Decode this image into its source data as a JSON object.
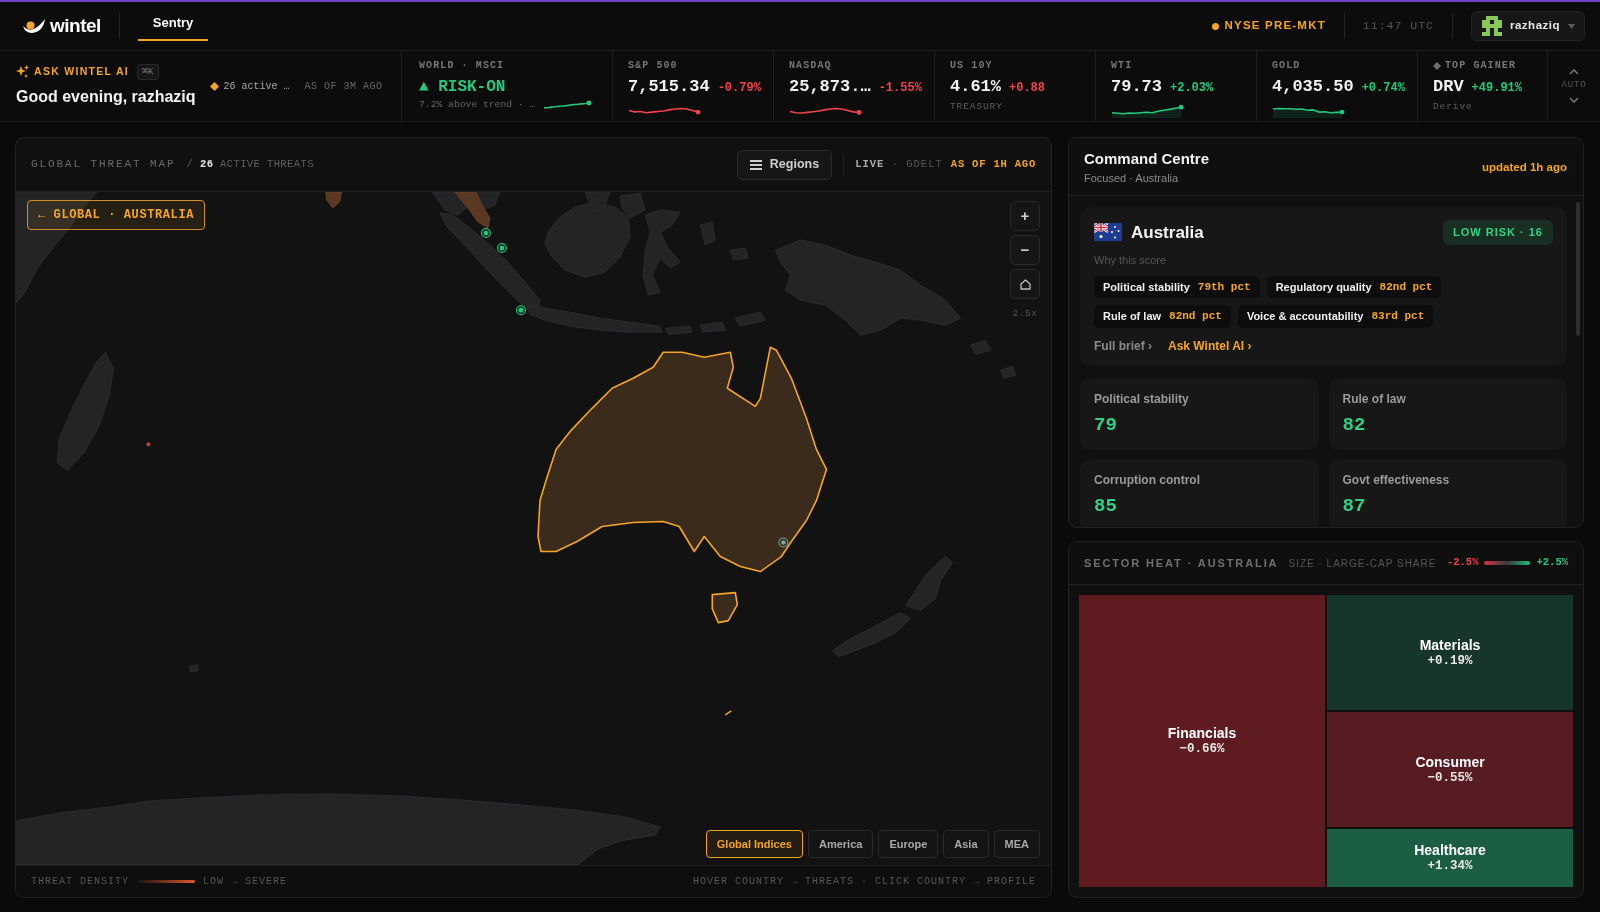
{
  "header": {
    "brand": "wintel",
    "tabs": [
      {
        "label": "Sentry",
        "selected": true
      }
    ],
    "market_status": "NYSE PRE-MKT",
    "clock": "11:47 UTC",
    "user": "razhaziq"
  },
  "ticker": {
    "assistant": {
      "label": "ASK WINTEL AI",
      "shortcut": "⌘K",
      "greeting": "Good evening, razhaziq",
      "alerts": "26 active …",
      "as_of": "AS OF 3M AGO"
    },
    "items": [
      {
        "kind": "signal",
        "label": "WORLD · MSCI",
        "value": "▲ RISK-ON",
        "note": "7.2% above trend · …",
        "color": "#22c97a"
      },
      {
        "kind": "quote",
        "label": "S&P 500",
        "value": "7,515.34",
        "change": "-0.79%",
        "color": "#f0434b"
      },
      {
        "kind": "quote",
        "label": "NASDAQ",
        "value": "25,873.…",
        "change": "-1.55%",
        "color": "#f0434b"
      },
      {
        "kind": "quote",
        "label": "US 10Y",
        "value": "4.61%",
        "change": "+0.88",
        "color": "#f0434b",
        "note": "TREASURY"
      },
      {
        "kind": "quote",
        "label": "WTI",
        "value": "79.73",
        "change": "+2.03%",
        "color": "#22c97a"
      },
      {
        "kind": "quote",
        "label": "GOLD",
        "value": "4,035.50",
        "change": "+0.74%",
        "color": "#22c97a"
      },
      {
        "kind": "gainer",
        "label": "TOP GAINER",
        "value": "DRV",
        "change": "+49.91%",
        "color": "#22c97a",
        "note": "Derive"
      }
    ],
    "auto": "AUTO"
  },
  "threat_map": {
    "title": "GLOBAL THREAT MAP",
    "subtitle": "/ **26** ACTIVE THREATS",
    "regions_button": "Regions",
    "feed": "**LIVE** · GDELT",
    "as_of": "AS OF 1H AGO",
    "breadcrumb": "← GLOBAL · AUSTRALIA",
    "zoom_controls": [
      "+",
      "−"
    ],
    "zoom_level": "2.5x",
    "filters": [
      {
        "label": "Global Indices",
        "selected": true
      },
      {
        "label": "America",
        "selected": false
      },
      {
        "label": "Europe",
        "selected": false
      },
      {
        "label": "Asia",
        "selected": false
      },
      {
        "label": "MEA",
        "selected": false
      }
    ],
    "legend": {
      "label": "THREAT DENSITY",
      "range": "LOW → SEVERE"
    },
    "hint": "HOVER COUNTRY → THREATS · CLICK COUNTRY → PROFILE"
  },
  "command_centre": {
    "title": "Command Centre",
    "subtitle": "Focused · Australia",
    "updated": "updated 1h ago",
    "country": {
      "name": "Australia",
      "risk": {
        "label": "LOW RISK · 16",
        "color": "#2fd47f"
      },
      "why": "Why this score",
      "factors": [
        {
          "label": "Political stability",
          "value": "79th pct"
        },
        {
          "label": "Regulatory quality",
          "value": "82nd pct"
        },
        {
          "label": "Rule of law",
          "value": "82nd pct"
        },
        {
          "label": "Voice & accountability",
          "value": "83rd pct"
        }
      ],
      "links": [
        {
          "label": "Full brief ›",
          "kind": "secondary"
        },
        {
          "label": "Ask Wintel AI ›",
          "kind": "primary"
        }
      ]
    },
    "metrics": [
      {
        "label": "Political stability",
        "value": "79"
      },
      {
        "label": "Rule of law",
        "value": "82"
      },
      {
        "label": "Corruption control",
        "value": "85"
      },
      {
        "label": "Govt effectiveness",
        "value": "87"
      }
    ]
  },
  "sector_heat": {
    "title": "SECTOR HEAT · AUSTRALIA",
    "size_note": "SIZE · LARGE-CAP SHARE",
    "scale": [
      "-2.5%",
      "+2.5%"
    ],
    "sectors": [
      {
        "name": "Financials",
        "change": "−0.66%",
        "color": "#5e1c21"
      },
      {
        "name": "Materials",
        "change": "+0.19%",
        "color": "#17352a"
      },
      {
        "name": "Consumer",
        "change": "−0.55%",
        "color": "#561c21"
      },
      {
        "name": "Healthcare",
        "change": "+1.34%",
        "color": "#1c5e43"
      }
    ]
  }
}
